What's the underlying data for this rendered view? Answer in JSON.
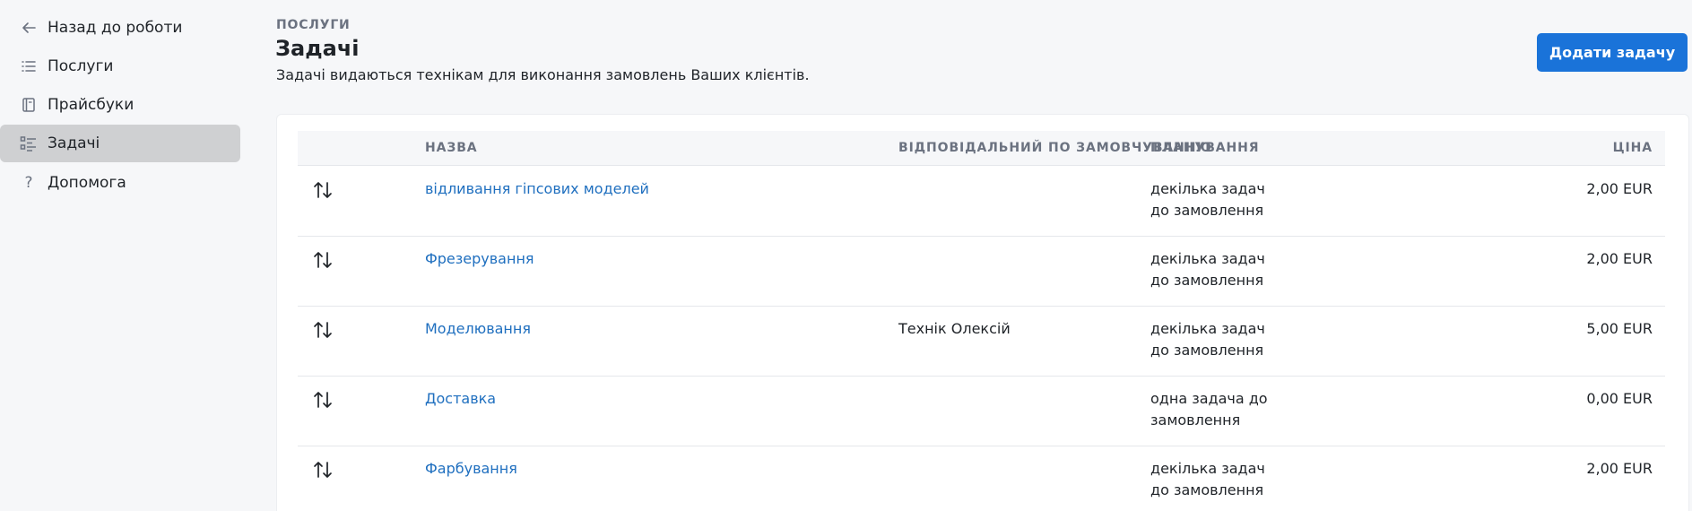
{
  "sidebar": {
    "items": [
      {
        "label": "Назад до роботи",
        "icon": "arrow-left-icon"
      },
      {
        "label": "Послуги",
        "icon": "list-icon"
      },
      {
        "label": "Прайсбуки",
        "icon": "book-icon"
      },
      {
        "label": "Задачі",
        "icon": "task-list-icon",
        "active": true
      },
      {
        "label": "Допомога",
        "icon": "question-icon"
      }
    ]
  },
  "header": {
    "eyebrow": "ПОСЛУГИ",
    "title": "Задачі",
    "subtitle": "Задачі видаються технікам для виконання замовлень Ваших клієнтів.",
    "add_button": "Додати задачу"
  },
  "table": {
    "columns": [
      "НАЗВА",
      "ВІДПОВІДАЛЬНИЙ ПО ЗАМОВЧУВАННЮ",
      "ПЛАНУВАННЯ",
      "ЦІНА"
    ],
    "rows": [
      {
        "name": "відливання гіпсових моделей",
        "responsible": "",
        "planning_1": "декілька задач",
        "planning_2": "до замовлення",
        "price": "2,00 EUR"
      },
      {
        "name": "Фрезерування",
        "responsible": "",
        "planning_1": "декілька задач",
        "planning_2": "до замовлення",
        "price": "2,00 EUR"
      },
      {
        "name": "Моделювання",
        "responsible": "Технік Олексій",
        "planning_1": "декілька задач",
        "planning_2": "до замовлення",
        "price": "5,00 EUR"
      },
      {
        "name": "Доставка",
        "responsible": "",
        "planning_1": "одна задача до",
        "planning_2": "замовлення",
        "price": "0,00 EUR"
      },
      {
        "name": "Фарбування",
        "responsible": "",
        "planning_1": "декілька задач",
        "planning_2": "до замовлення",
        "price": "2,00 EUR"
      }
    ]
  },
  "colors": {
    "accent": "#1a73d9",
    "link": "#1f6fbf",
    "active_nav": "#cfd0d2"
  }
}
